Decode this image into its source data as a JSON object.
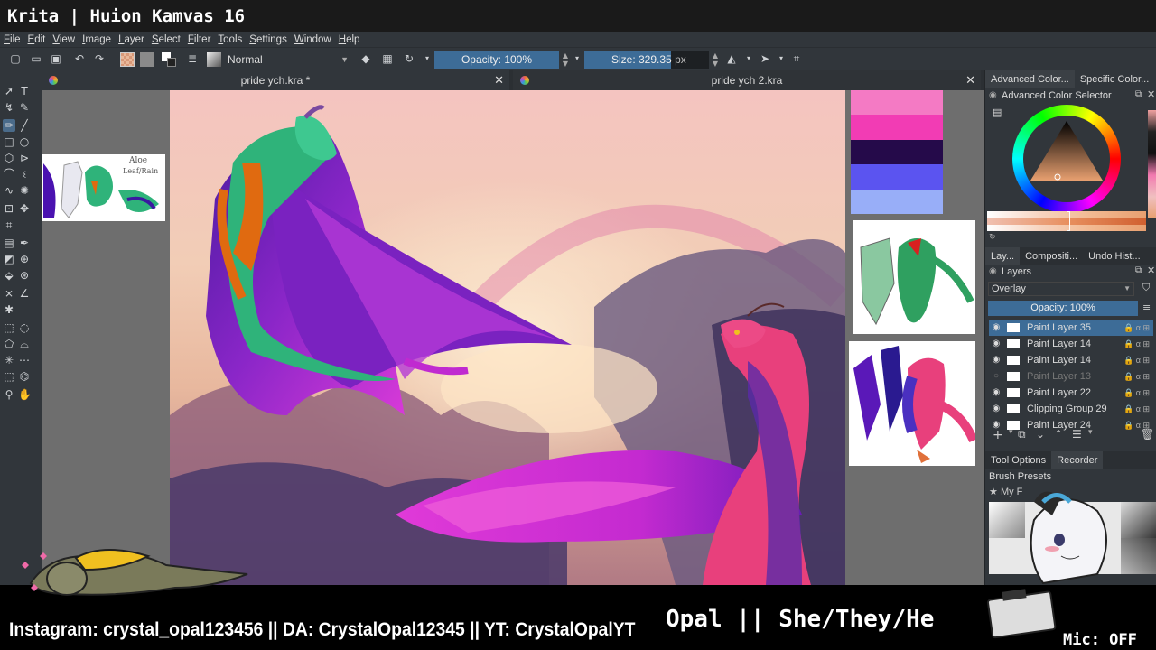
{
  "stream": {
    "title": "Krita | Huion Kamvas 16",
    "social": "Instagram: crystal_opal123456 || DA: CrystalOpal12345 || YT: CrystalOpalYT",
    "name_pronouns": "Opal || She/They/He",
    "mic": "Mic: OFF"
  },
  "menu": [
    "File",
    "Edit",
    "View",
    "Image",
    "Layer",
    "Select",
    "Filter",
    "Tools",
    "Settings",
    "Window",
    "Help"
  ],
  "toolbar": {
    "blend_mode": "Normal",
    "opacity_label": "Opacity: 100%",
    "opacity_value": 100,
    "size_label": "Size: 329.35",
    "size_unit": "px"
  },
  "documents": {
    "tabs": [
      {
        "label": "pride ych.kra *"
      },
      {
        "label": "pride ych 2.kra"
      }
    ]
  },
  "reference": {
    "aloe_note_1": "Aloe",
    "aloe_note_2": "Leaf/Rain"
  },
  "docker": {
    "color_tabs": [
      "Advanced Color...",
      "Specific Color..."
    ],
    "color_header": "Advanced Color Selector",
    "layer_tabs": [
      "Lay...",
      "Compositi...",
      "Undo Hist..."
    ],
    "layers_header": "Layers",
    "layer_blend": "Overlay",
    "layer_opacity": "Opacity: 100%",
    "layers": [
      {
        "name": "Paint Layer 35",
        "selected": true,
        "visible": true
      },
      {
        "name": "Paint Layer 14",
        "selected": false,
        "visible": true
      },
      {
        "name": "Paint Layer 14",
        "selected": false,
        "visible": true
      },
      {
        "name": "Paint Layer 13",
        "selected": false,
        "visible": false
      },
      {
        "name": "Paint Layer 22",
        "selected": false,
        "visible": true
      },
      {
        "name": "Clipping Group 29",
        "selected": false,
        "visible": true
      },
      {
        "name": "Paint Layer 24",
        "selected": false,
        "visible": true
      }
    ],
    "bottom_tabs": [
      "Tool Options",
      "Recorder"
    ],
    "brush_presets": "Brush Presets",
    "brush_tag": "My F"
  },
  "palette_colors": [
    "#f47ac4",
    "#f23cb4",
    "#250a4a",
    "#5b54f0",
    "#98aef8"
  ],
  "colors": {
    "ui_bg": "#31363b",
    "accent": "#3d6c97",
    "canvas_bg": "#6e6e6e"
  }
}
